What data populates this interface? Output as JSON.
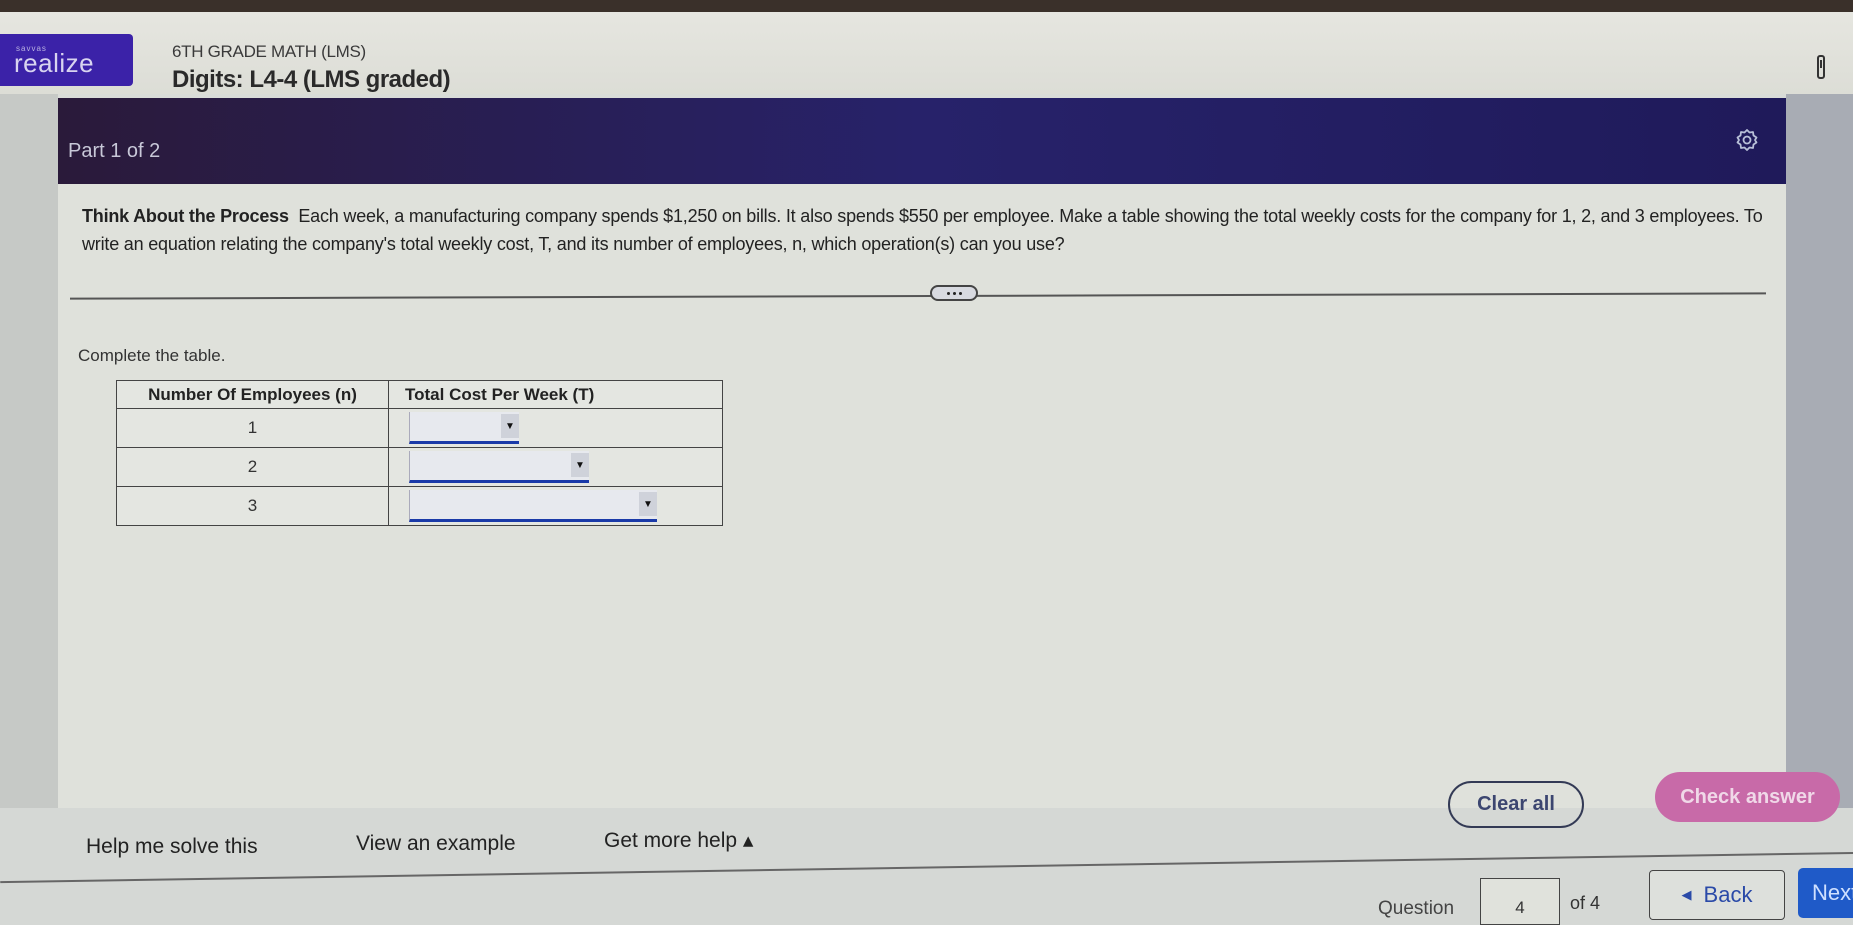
{
  "app": {
    "logo_small": "savvas",
    "logo_text": "realize",
    "course_title": "6TH GRADE MATH (LMS)",
    "lesson_title": "Digits: L4-4 (LMS graded)",
    "header_icon": "paper-icon"
  },
  "question": {
    "part_label": "Part 1 of 2",
    "settings_icon": "gear-icon",
    "prompt_bold": "Think About the Process",
    "prompt_text": "Each week, a manufacturing company spends $1,250 on bills. It also spends $550 per employee. Make a table showing the total weekly costs for the company for 1, 2, and 3 employees. To write an equation relating the company's total weekly cost, T, and its number of employees, n, which operation(s) can you use?",
    "more_button_icon": "ellipsis-icon",
    "instruction": "Complete the table."
  },
  "table": {
    "headers": [
      "Number Of Employees (n)",
      "Total Cost Per Week (T)"
    ],
    "rows": [
      {
        "n": "1",
        "t_value": ""
      },
      {
        "n": "2",
        "t_value": ""
      },
      {
        "n": "3",
        "t_value": ""
      }
    ],
    "dropdown_icon": "triangle-down-icon"
  },
  "help": {
    "help_me_solve": "Help me solve this",
    "view_example": "View an example",
    "get_more_help": "Get more help ▴"
  },
  "actions": {
    "clear_all": "Clear all",
    "check_answer": "Check answer"
  },
  "navigation": {
    "question_label": "Question",
    "current_question": "4",
    "of_total": "of 4",
    "back_label": "Back",
    "next_label": "Next"
  },
  "colors": {
    "logo_bg": "#3b22a8",
    "part_bar": "#27226a",
    "check_answer_bg": "#c86aa8",
    "next_bg": "#1f5ac8",
    "dropdown_underline": "#1a3aa8"
  }
}
